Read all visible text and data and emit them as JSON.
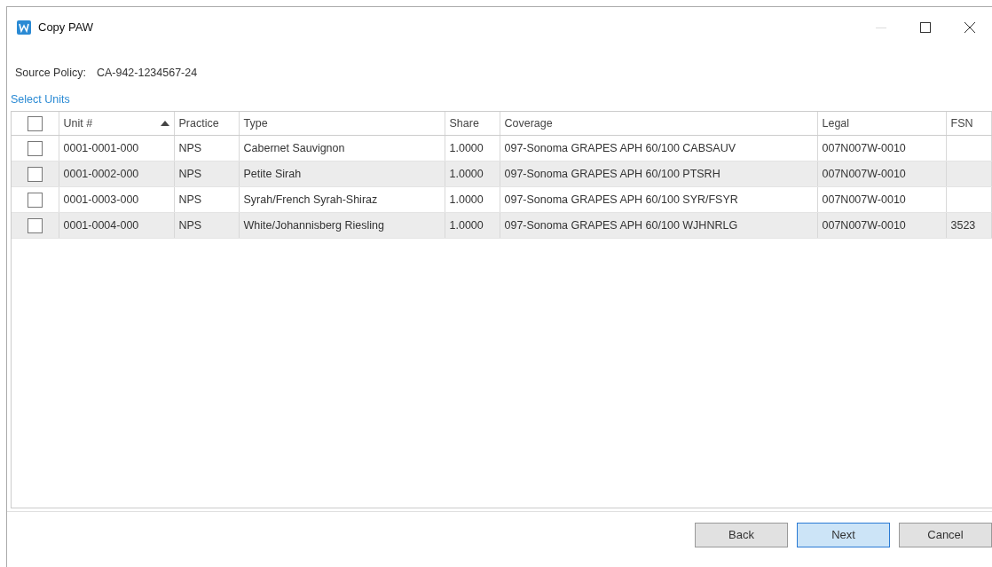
{
  "window": {
    "title": "Copy PAW"
  },
  "source_policy": {
    "label": "Source Policy:",
    "value": "CA-942-1234567-24"
  },
  "section_title": "Select Units",
  "table": {
    "select_all_checked": false,
    "columns": [
      {
        "label": "Unit #",
        "sorted": true
      },
      {
        "label": "Practice",
        "sorted": false
      },
      {
        "label": "Type",
        "sorted": false
      },
      {
        "label": "Share",
        "sorted": false
      },
      {
        "label": "Coverage",
        "sorted": false
      },
      {
        "label": "Legal",
        "sorted": false
      },
      {
        "label": "FSN",
        "sorted": false
      }
    ],
    "rows": [
      {
        "checked": false,
        "cells": [
          "0001-0001-000",
          "NPS",
          "Cabernet Sauvignon",
          "1.0000",
          "097-Sonoma GRAPES APH 60/100 CABSAUV",
          "007N007W-0010",
          ""
        ]
      },
      {
        "checked": false,
        "cells": [
          "0001-0002-000",
          "NPS",
          "Petite Sirah",
          "1.0000",
          "097-Sonoma GRAPES APH 60/100 PTSRH",
          "007N007W-0010",
          ""
        ]
      },
      {
        "checked": false,
        "cells": [
          "0001-0003-000",
          "NPS",
          "Syrah/French Syrah-Shiraz",
          "1.0000",
          "097-Sonoma GRAPES APH 60/100 SYR/FSYR",
          "007N007W-0010",
          ""
        ]
      },
      {
        "checked": false,
        "cells": [
          "0001-0004-000",
          "NPS",
          "White/Johannisberg Riesling",
          "1.0000",
          "097-Sonoma GRAPES APH 60/100 WJHNRLG",
          "007N007W-0010",
          "3523"
        ]
      }
    ]
  },
  "buttons": [
    {
      "label": "Back",
      "default": false
    },
    {
      "label": "Next",
      "default": true
    },
    {
      "label": "Cancel",
      "default": false
    }
  ]
}
